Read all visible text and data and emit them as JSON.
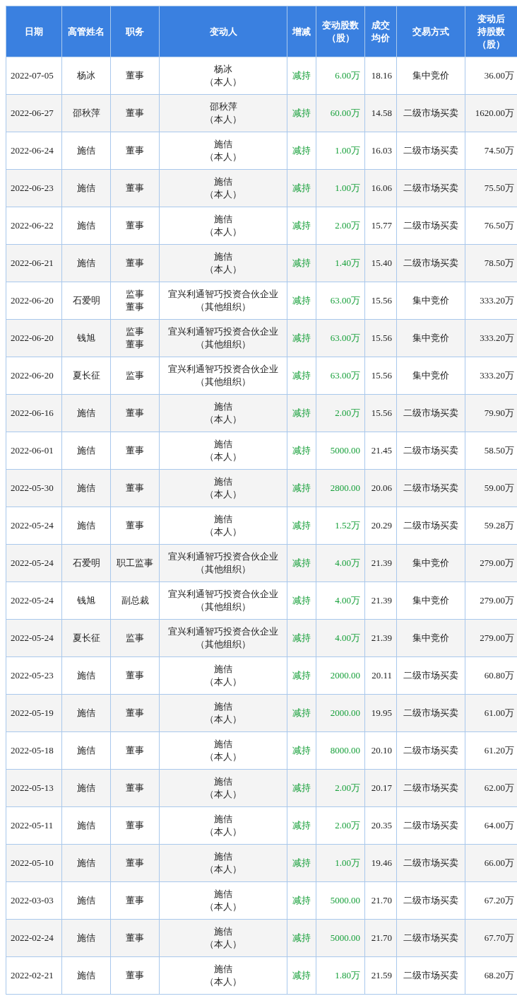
{
  "table": {
    "columns": [
      [
        "日期"
      ],
      [
        "高管姓名"
      ],
      [
        "职务"
      ],
      [
        "变动人"
      ],
      [
        "增减"
      ],
      [
        "变动股数",
        "（股）"
      ],
      [
        "成交",
        "均价"
      ],
      [
        "交易方式"
      ],
      [
        "变动后",
        "持股数",
        "（股）"
      ]
    ],
    "rows": [
      {
        "date": "2022-07-05",
        "name": "杨冰",
        "position": [
          "董事"
        ],
        "changer": [
          "杨冰",
          "（本人）"
        ],
        "change": "减持",
        "shares": "6.00万",
        "price": "18.16",
        "method": "集中竞价",
        "holding": "36.00万"
      },
      {
        "date": "2022-06-27",
        "name": "邵秋萍",
        "position": [
          "董事"
        ],
        "changer": [
          "邵秋萍",
          "（本人）"
        ],
        "change": "减持",
        "shares": "60.00万",
        "price": "14.58",
        "method": "二级市场买卖",
        "holding": "1620.00万"
      },
      {
        "date": "2022-06-24",
        "name": "施佶",
        "position": [
          "董事"
        ],
        "changer": [
          "施佶",
          "（本人）"
        ],
        "change": "减持",
        "shares": "1.00万",
        "price": "16.03",
        "method": "二级市场买卖",
        "holding": "74.50万"
      },
      {
        "date": "2022-06-23",
        "name": "施佶",
        "position": [
          "董事"
        ],
        "changer": [
          "施佶",
          "（本人）"
        ],
        "change": "减持",
        "shares": "1.00万",
        "price": "16.06",
        "method": "二级市场买卖",
        "holding": "75.50万"
      },
      {
        "date": "2022-06-22",
        "name": "施佶",
        "position": [
          "董事"
        ],
        "changer": [
          "施佶",
          "（本人）"
        ],
        "change": "减持",
        "shares": "2.00万",
        "price": "15.77",
        "method": "二级市场买卖",
        "holding": "76.50万"
      },
      {
        "date": "2022-06-21",
        "name": "施佶",
        "position": [
          "董事"
        ],
        "changer": [
          "施佶",
          "（本人）"
        ],
        "change": "减持",
        "shares": "1.40万",
        "price": "15.40",
        "method": "二级市场买卖",
        "holding": "78.50万"
      },
      {
        "date": "2022-06-20",
        "name": "石爱明",
        "position": [
          "监事",
          "董事"
        ],
        "changer": [
          "宜兴利通智巧投资合伙企业",
          "（其他组织）"
        ],
        "change": "减持",
        "shares": "63.00万",
        "price": "15.56",
        "method": "集中竞价",
        "holding": "333.20万"
      },
      {
        "date": "2022-06-20",
        "name": "钱旭",
        "position": [
          "监事",
          "董事"
        ],
        "changer": [
          "宜兴利通智巧投资合伙企业",
          "（其他组织）"
        ],
        "change": "减持",
        "shares": "63.00万",
        "price": "15.56",
        "method": "集中竞价",
        "holding": "333.20万"
      },
      {
        "date": "2022-06-20",
        "name": "夏长征",
        "position": [
          "监事"
        ],
        "changer": [
          "宜兴利通智巧投资合伙企业",
          "（其他组织）"
        ],
        "change": "减持",
        "shares": "63.00万",
        "price": "15.56",
        "method": "集中竞价",
        "holding": "333.20万"
      },
      {
        "date": "2022-06-16",
        "name": "施佶",
        "position": [
          "董事"
        ],
        "changer": [
          "施佶",
          "（本人）"
        ],
        "change": "减持",
        "shares": "2.00万",
        "price": "15.56",
        "method": "二级市场买卖",
        "holding": "79.90万"
      },
      {
        "date": "2022-06-01",
        "name": "施佶",
        "position": [
          "董事"
        ],
        "changer": [
          "施佶",
          "（本人）"
        ],
        "change": "减持",
        "shares": "5000.00",
        "price": "21.45",
        "method": "二级市场买卖",
        "holding": "58.50万"
      },
      {
        "date": "2022-05-30",
        "name": "施佶",
        "position": [
          "董事"
        ],
        "changer": [
          "施佶",
          "（本人）"
        ],
        "change": "减持",
        "shares": "2800.00",
        "price": "20.06",
        "method": "二级市场买卖",
        "holding": "59.00万"
      },
      {
        "date": "2022-05-24",
        "name": "施佶",
        "position": [
          "董事"
        ],
        "changer": [
          "施佶",
          "（本人）"
        ],
        "change": "减持",
        "shares": "1.52万",
        "price": "20.29",
        "method": "二级市场买卖",
        "holding": "59.28万"
      },
      {
        "date": "2022-05-24",
        "name": "石爱明",
        "position": [
          "职工监事"
        ],
        "changer": [
          "宜兴利通智巧投资合伙企业",
          "（其他组织）"
        ],
        "change": "减持",
        "shares": "4.00万",
        "price": "21.39",
        "method": "集中竞价",
        "holding": "279.00万"
      },
      {
        "date": "2022-05-24",
        "name": "钱旭",
        "position": [
          "副总裁"
        ],
        "changer": [
          "宜兴利通智巧投资合伙企业",
          "（其他组织）"
        ],
        "change": "减持",
        "shares": "4.00万",
        "price": "21.39",
        "method": "集中竞价",
        "holding": "279.00万"
      },
      {
        "date": "2022-05-24",
        "name": "夏长征",
        "position": [
          "监事"
        ],
        "changer": [
          "宜兴利通智巧投资合伙企业",
          "（其他组织）"
        ],
        "change": "减持",
        "shares": "4.00万",
        "price": "21.39",
        "method": "集中竞价",
        "holding": "279.00万"
      },
      {
        "date": "2022-05-23",
        "name": "施佶",
        "position": [
          "董事"
        ],
        "changer": [
          "施佶",
          "（本人）"
        ],
        "change": "减持",
        "shares": "2000.00",
        "price": "20.11",
        "method": "二级市场买卖",
        "holding": "60.80万"
      },
      {
        "date": "2022-05-19",
        "name": "施佶",
        "position": [
          "董事"
        ],
        "changer": [
          "施佶",
          "（本人）"
        ],
        "change": "减持",
        "shares": "2000.00",
        "price": "19.95",
        "method": "二级市场买卖",
        "holding": "61.00万"
      },
      {
        "date": "2022-05-18",
        "name": "施佶",
        "position": [
          "董事"
        ],
        "changer": [
          "施佶",
          "（本人）"
        ],
        "change": "减持",
        "shares": "8000.00",
        "price": "20.10",
        "method": "二级市场买卖",
        "holding": "61.20万"
      },
      {
        "date": "2022-05-13",
        "name": "施佶",
        "position": [
          "董事"
        ],
        "changer": [
          "施佶",
          "（本人）"
        ],
        "change": "减持",
        "shares": "2.00万",
        "price": "20.17",
        "method": "二级市场买卖",
        "holding": "62.00万"
      },
      {
        "date": "2022-05-11",
        "name": "施佶",
        "position": [
          "董事"
        ],
        "changer": [
          "施佶",
          "（本人）"
        ],
        "change": "减持",
        "shares": "2.00万",
        "price": "20.35",
        "method": "二级市场买卖",
        "holding": "64.00万"
      },
      {
        "date": "2022-05-10",
        "name": "施佶",
        "position": [
          "董事"
        ],
        "changer": [
          "施佶",
          "（本人）"
        ],
        "change": "减持",
        "shares": "1.00万",
        "price": "19.46",
        "method": "二级市场买卖",
        "holding": "66.00万"
      },
      {
        "date": "2022-03-03",
        "name": "施佶",
        "position": [
          "董事"
        ],
        "changer": [
          "施佶",
          "（本人）"
        ],
        "change": "减持",
        "shares": "5000.00",
        "price": "21.70",
        "method": "二级市场买卖",
        "holding": "67.20万"
      },
      {
        "date": "2022-02-24",
        "name": "施佶",
        "position": [
          "董事"
        ],
        "changer": [
          "施佶",
          "（本人）"
        ],
        "change": "减持",
        "shares": "5000.00",
        "price": "21.70",
        "method": "二级市场买卖",
        "holding": "67.70万"
      },
      {
        "date": "2022-02-21",
        "name": "施佶",
        "position": [
          "董事"
        ],
        "changer": [
          "施佶",
          "（本人）"
        ],
        "change": "减持",
        "shares": "1.80万",
        "price": "21.59",
        "method": "二级市场买卖",
        "holding": "68.20万"
      }
    ]
  }
}
